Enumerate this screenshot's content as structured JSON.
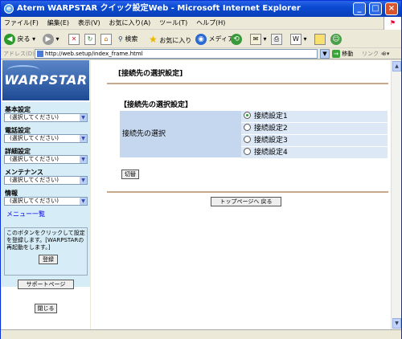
{
  "window": {
    "title": "Aterm WARPSTAR クイック設定Web - Microsoft Internet Explorer"
  },
  "menubar": {
    "items": [
      "ファイル(F)",
      "編集(E)",
      "表示(V)",
      "お気に入り(A)",
      "ツール(T)",
      "ヘルプ(H)"
    ]
  },
  "toolbar": {
    "back": "戻る",
    "search": "検索",
    "favorites": "お気に入り",
    "media": "メディア"
  },
  "address": {
    "label": "アドレス(D)",
    "url": "http://web.setup/index_frame.html",
    "go": "移動",
    "links": "リンク"
  },
  "sidebar": {
    "logo": "WARPSTAR",
    "groups": [
      {
        "label": "基本設定",
        "select": "(選択してください)"
      },
      {
        "label": "電話設定",
        "select": "(選択してください)"
      },
      {
        "label": "詳細設定",
        "select": "(選択してください)"
      },
      {
        "label": "メンテナンス",
        "select": "(選択してください)"
      },
      {
        "label": "情報",
        "select": "(選択してください)"
      }
    ],
    "menu_link": "メニュー一覧",
    "note": "このボタンをクリックして設定を登録します。[WARPSTARの再起動をします。]",
    "register_button": "登録",
    "support_button": "サポートページ",
    "close_button": "閉じる"
  },
  "main": {
    "page_title": "[接続先の選択設定]",
    "section_title": "【接続先の選択設定】",
    "row_label": "接続先の選択",
    "options": [
      "接続設定1",
      "接続設定2",
      "接続設定3",
      "接続設定4"
    ],
    "selected_index": 0,
    "switch_button": "切替",
    "top_button": "トップページへ 戻る"
  }
}
